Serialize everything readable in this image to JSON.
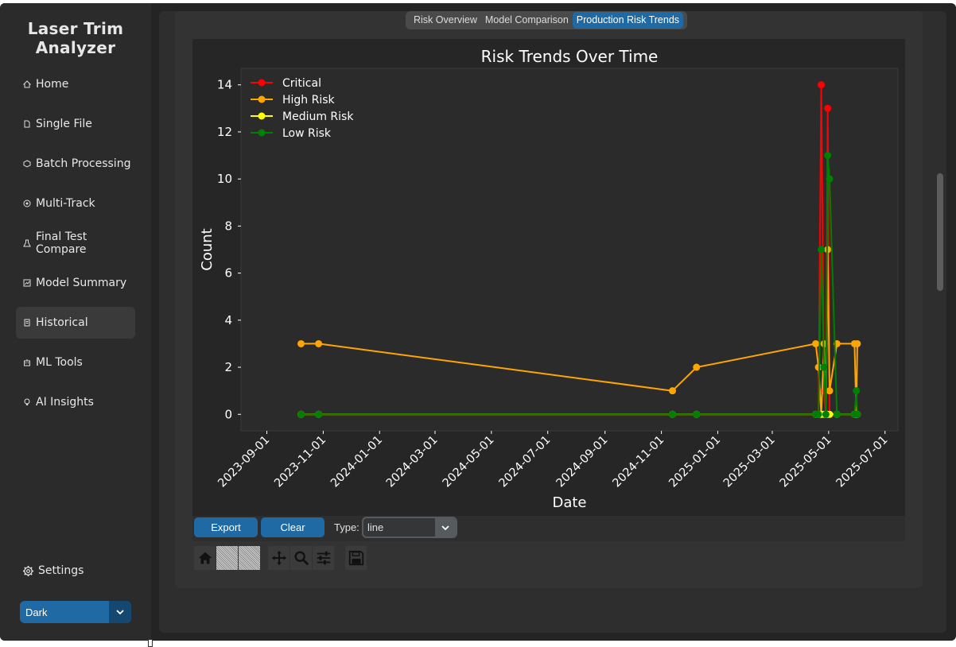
{
  "app": {
    "title": "Laser Trim Analyzer"
  },
  "sidebar": {
    "items": [
      {
        "label": "Home",
        "icon": "home-icon"
      },
      {
        "label": "Single File",
        "icon": "file-icon"
      },
      {
        "label": "Batch Processing",
        "icon": "package-icon"
      },
      {
        "label": "Multi-Track",
        "icon": "target-icon"
      },
      {
        "label": "Final Test Compare",
        "icon": "flask-icon"
      },
      {
        "label": "Model Summary",
        "icon": "chart-icon"
      },
      {
        "label": "Historical",
        "icon": "scroll-icon",
        "active": true
      },
      {
        "label": "ML Tools",
        "icon": "robot-icon"
      },
      {
        "label": "AI Insights",
        "icon": "bulb-icon"
      }
    ],
    "settings_label": "Settings",
    "theme": {
      "selected": "Dark"
    }
  },
  "tabs": [
    {
      "label": "Risk Overview",
      "active": false
    },
    {
      "label": "Model Comparison",
      "active": false
    },
    {
      "label": "Production Risk Trends",
      "active": true
    }
  ],
  "controls": {
    "export_label": "Export",
    "clear_label": "Clear",
    "type_label": "Type:",
    "type_value": "line"
  },
  "toolbar": {
    "tools": [
      "home-icon",
      "back-icon",
      "forward-icon",
      "pan-icon",
      "zoom-icon",
      "configure-icon",
      "save-icon"
    ]
  },
  "colors": {
    "accent": "#1f6aa5",
    "critical": "#ff0000",
    "high": "#ffa500",
    "medium": "#ffff00",
    "low": "#008000"
  },
  "chart_data": {
    "type": "line",
    "title": "Risk Trends Over Time",
    "xlabel": "Date",
    "ylabel": "Count",
    "x_tick_labels": [
      "2023-09-01",
      "2023-11-01",
      "2024-01-01",
      "2024-03-01",
      "2024-05-01",
      "2024-07-01",
      "2024-09-01",
      "2024-11-01",
      "2025-01-01",
      "2025-03-01",
      "2025-05-01",
      "2025-07-01"
    ],
    "y_ticks": [
      0,
      2,
      4,
      6,
      8,
      10,
      12,
      14
    ],
    "xlim": [
      "2023-08-04",
      "2025-07-15"
    ],
    "ylim": [
      -0.7,
      14.7
    ],
    "legend": "top-left",
    "grid": false,
    "series": [
      {
        "name": "Critical",
        "color": "#ff0000",
        "points": [
          [
            "2023-10-08",
            0
          ],
          [
            "2023-10-27",
            0
          ],
          [
            "2024-11-13",
            0
          ],
          [
            "2024-12-09",
            0
          ],
          [
            "2025-04-17",
            0
          ],
          [
            "2025-04-20",
            0
          ],
          [
            "2025-04-23",
            14
          ],
          [
            "2025-04-26",
            1
          ],
          [
            "2025-04-28",
            0
          ],
          [
            "2025-04-30",
            13
          ],
          [
            "2025-05-02",
            0
          ],
          [
            "2025-05-10",
            0
          ],
          [
            "2025-05-29",
            0
          ],
          [
            "2025-05-31",
            0
          ],
          [
            "2025-06-01",
            0
          ]
        ]
      },
      {
        "name": "High Risk",
        "color": "#ffa500",
        "points": [
          [
            "2023-10-08",
            3
          ],
          [
            "2023-10-27",
            3
          ],
          [
            "2024-11-13",
            1
          ],
          [
            "2024-12-09",
            2
          ],
          [
            "2025-04-17",
            3
          ],
          [
            "2025-04-20",
            2
          ],
          [
            "2025-04-23",
            0
          ],
          [
            "2025-04-26",
            3
          ],
          [
            "2025-04-28",
            0
          ],
          [
            "2025-04-30",
            7
          ],
          [
            "2025-05-02",
            1
          ],
          [
            "2025-05-10",
            3
          ],
          [
            "2025-05-29",
            3
          ],
          [
            "2025-05-31",
            0
          ],
          [
            "2025-06-01",
            3
          ]
        ]
      },
      {
        "name": "Medium Risk",
        "color": "#ffff00",
        "points": [
          [
            "2023-10-08",
            0
          ],
          [
            "2023-10-27",
            0
          ],
          [
            "2024-11-13",
            0
          ],
          [
            "2024-12-09",
            0
          ],
          [
            "2025-04-17",
            0
          ],
          [
            "2025-04-20",
            0
          ],
          [
            "2025-04-23",
            0
          ],
          [
            "2025-04-26",
            0
          ],
          [
            "2025-04-28",
            0
          ],
          [
            "2025-04-30",
            0
          ],
          [
            "2025-05-02",
            0
          ],
          [
            "2025-05-10",
            0
          ],
          [
            "2025-05-29",
            0
          ],
          [
            "2025-05-31",
            0
          ],
          [
            "2025-06-01",
            0
          ]
        ]
      },
      {
        "name": "Low Risk",
        "color": "#008000",
        "points": [
          [
            "2023-10-08",
            0
          ],
          [
            "2023-10-27",
            0
          ],
          [
            "2024-11-13",
            0
          ],
          [
            "2024-12-09",
            0
          ],
          [
            "2025-04-17",
            0
          ],
          [
            "2025-04-20",
            0
          ],
          [
            "2025-04-23",
            7
          ],
          [
            "2025-04-26",
            2
          ],
          [
            "2025-04-28",
            0
          ],
          [
            "2025-04-30",
            11
          ],
          [
            "2025-05-02",
            10
          ],
          [
            "2025-05-10",
            0
          ],
          [
            "2025-05-29",
            0
          ],
          [
            "2025-05-31",
            1
          ],
          [
            "2025-06-01",
            0
          ]
        ]
      }
    ]
  }
}
